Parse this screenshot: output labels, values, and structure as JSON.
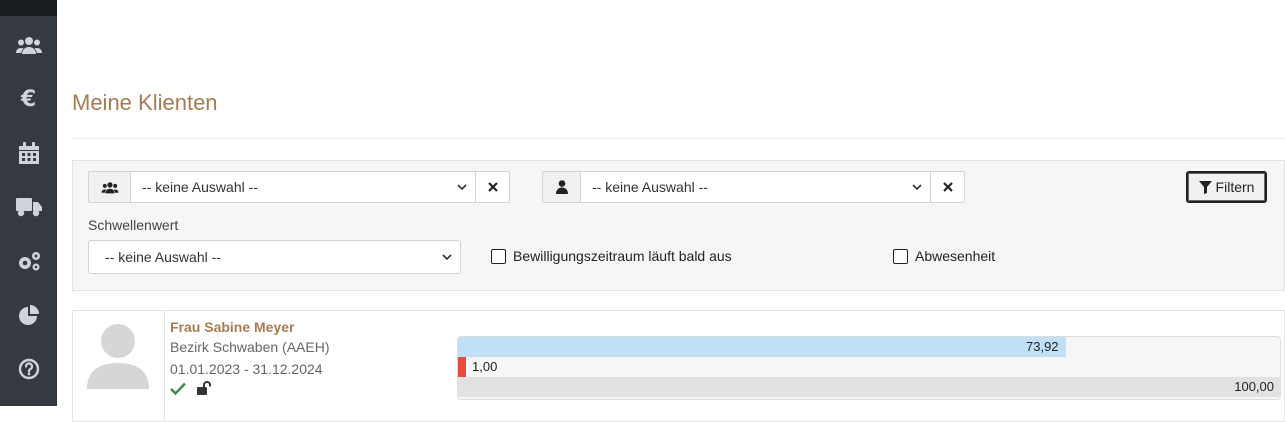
{
  "sidebar": {
    "items": [
      {
        "icon": "users-icon"
      },
      {
        "icon": "euro-icon",
        "glyph": "€"
      },
      {
        "icon": "calendar-icon"
      },
      {
        "icon": "truck-icon"
      },
      {
        "icon": "cogs-icon"
      },
      {
        "icon": "pie-chart-icon"
      },
      {
        "icon": "question-icon"
      }
    ]
  },
  "page": {
    "title": "Meine Klienten"
  },
  "filters": {
    "group_select": {
      "value": "-- keine Auswahl --",
      "icon": "users-icon"
    },
    "person_select": {
      "value": "-- keine Auswahl --",
      "icon": "user-icon"
    },
    "filter_button_label": "Filtern",
    "schwellenwert_label": "Schwellenwert",
    "schwellenwert_select": {
      "value": "-- keine Auswahl --"
    },
    "checkbox_bewilligung": {
      "label": "Bewilligungszeitraum läuft bald aus",
      "checked": false
    },
    "checkbox_abwesenheit": {
      "label": "Abwesenheit",
      "checked": false
    }
  },
  "clients": [
    {
      "name": "Frau Sabine Meyer",
      "bezirk": "Bezirk Schwaben (AAEH)",
      "period": "01.01.2023 - 31.12.2024",
      "status_icons": [
        "check-icon",
        "unlock-icon"
      ],
      "bars": [
        {
          "label": "73,92",
          "percent": 73.92,
          "color": "#bfe0f5"
        },
        {
          "label": "1,00",
          "percent": 1.0,
          "color": "#e74c3c"
        },
        {
          "label": "100,00",
          "percent": 100.0,
          "color": "#e2e2e2"
        }
      ]
    }
  ],
  "colors": {
    "accent": "#a67c52",
    "sidebar": "#343a40"
  }
}
